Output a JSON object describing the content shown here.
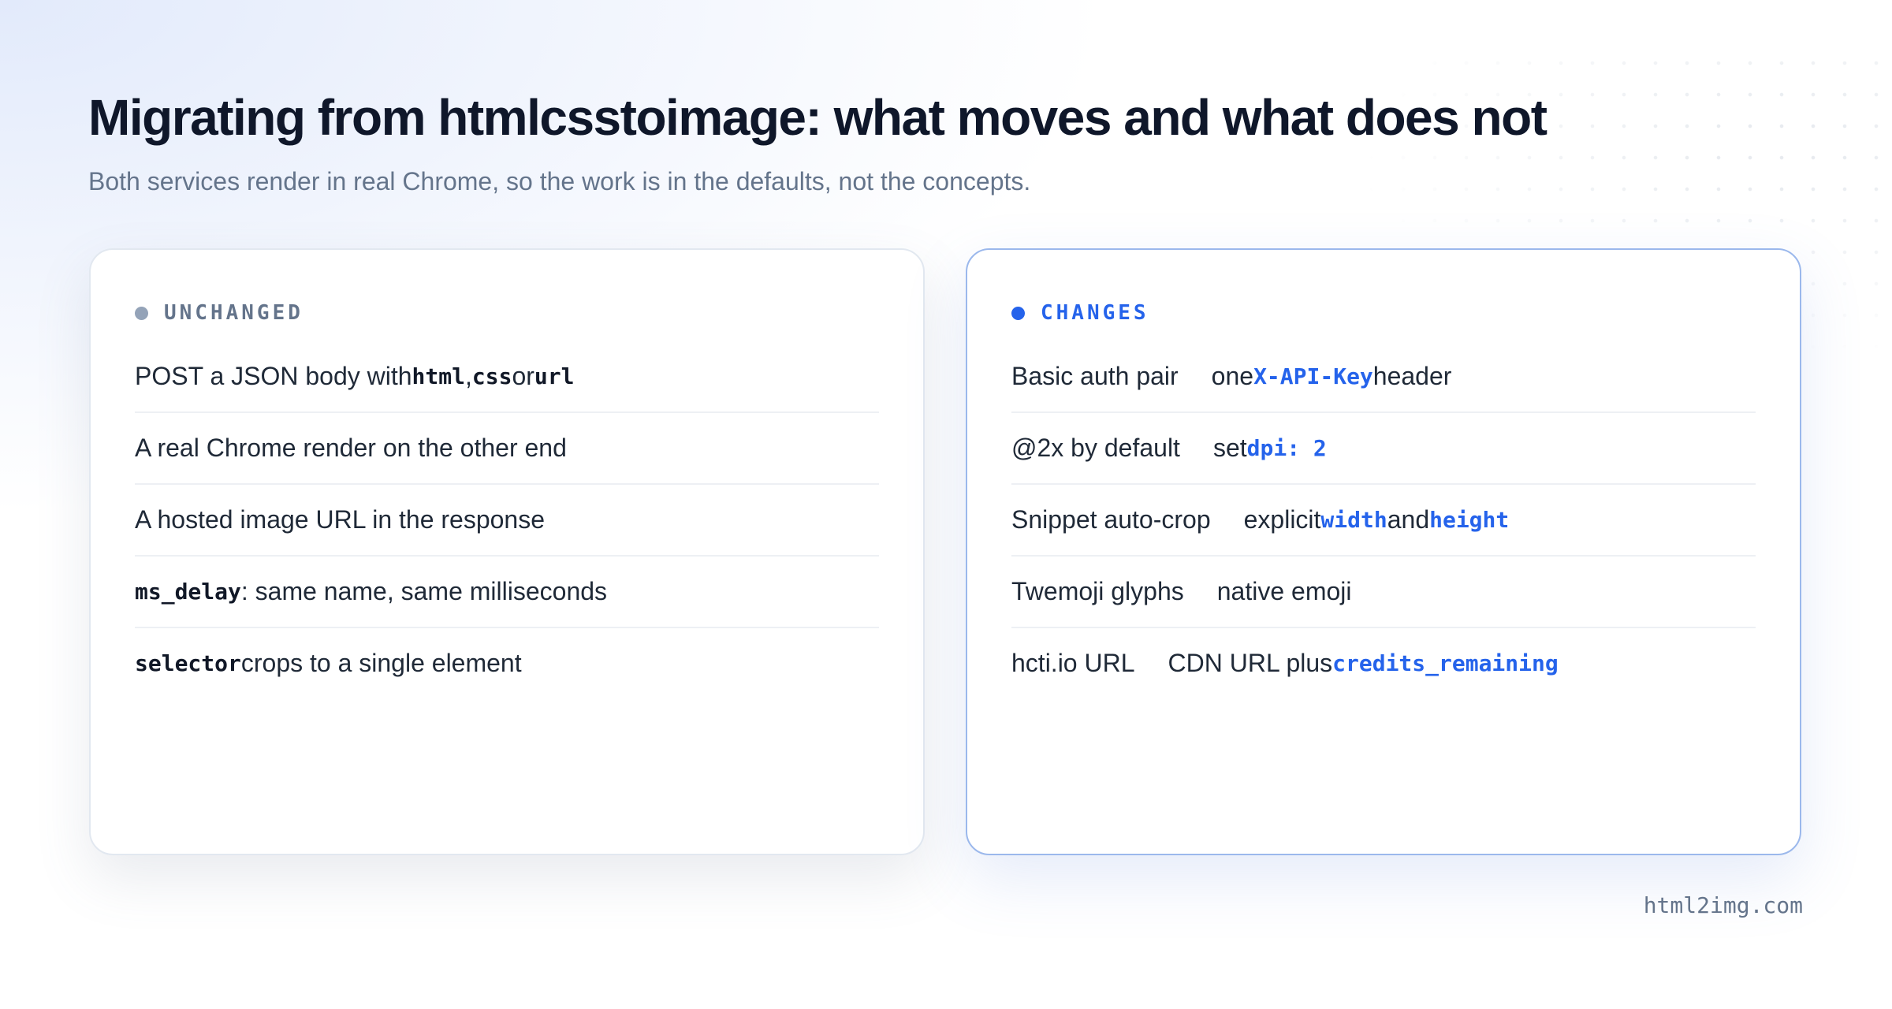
{
  "title": "Migrating from htmlcsstoimage: what moves and what does not",
  "subtitle": "Both services render in real Chrome, so the work is in the defaults, not the concepts.",
  "colors": {
    "unchanged_dot": "#94a3b8",
    "unchanged_label": "#64748b",
    "changes_dot": "#2563eb",
    "changes_label": "#2563eb"
  },
  "unchanged": {
    "label": "UNCHANGED",
    "rows": [
      {
        "t1": "POST a JSON body with ",
        "c1": "html",
        "t2": ", ",
        "c2": "css",
        "t3": " or ",
        "c3": "url"
      },
      {
        "t1": "A real Chrome render on the other end"
      },
      {
        "t1": "A hosted image URL in the response"
      },
      {
        "c1": "ms_delay",
        "t2": ": same name, same milliseconds"
      },
      {
        "c1": "selector",
        "t2": " crops to a single element"
      }
    ]
  },
  "changes": {
    "label": "CHANGES",
    "rows": [
      {
        "from": "Basic auth pair",
        "t1": "one ",
        "c1": "X-API-Key",
        "t2": " header"
      },
      {
        "from": "@2x by default",
        "t1": "set ",
        "c1": "dpi: 2"
      },
      {
        "from": "Snippet auto-crop",
        "t1": "explicit ",
        "c1": "width",
        "t2": " and ",
        "c2": "height"
      },
      {
        "from": "Twemoji glyphs",
        "t1": "native emoji"
      },
      {
        "from": "hcti.io URL",
        "t1": "CDN URL plus ",
        "c1": "credits_remaining"
      }
    ]
  },
  "footer": "html2img.com"
}
